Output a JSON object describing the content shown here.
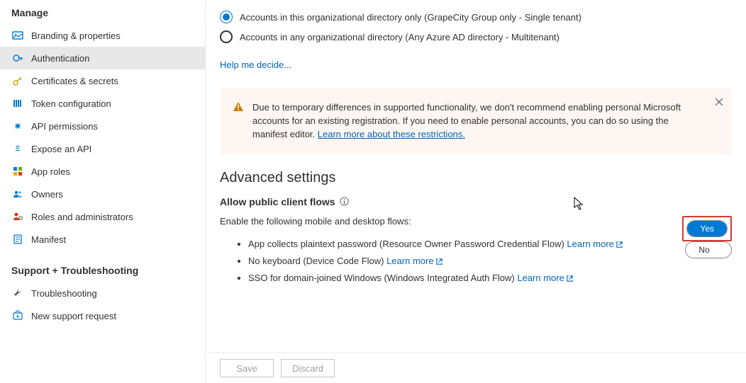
{
  "sidebar": {
    "heading_manage": "Manage",
    "heading_support": "Support + Troubleshooting",
    "items": [
      {
        "label": "Branding & properties",
        "icon": "branding"
      },
      {
        "label": "Authentication",
        "icon": "auth",
        "active": true
      },
      {
        "label": "Certificates & secrets",
        "icon": "key"
      },
      {
        "label": "Token configuration",
        "icon": "token"
      },
      {
        "label": "API permissions",
        "icon": "api-perm"
      },
      {
        "label": "Expose an API",
        "icon": "expose"
      },
      {
        "label": "App roles",
        "icon": "app-roles"
      },
      {
        "label": "Owners",
        "icon": "owners"
      },
      {
        "label": "Roles and administrators",
        "icon": "roles-admin"
      },
      {
        "label": "Manifest",
        "icon": "manifest"
      }
    ],
    "support_items": [
      {
        "label": "Troubleshooting",
        "icon": "wrench"
      },
      {
        "label": "New support request",
        "icon": "support"
      }
    ]
  },
  "radios": {
    "opt1": "Accounts in this organizational directory only (GrapeCity Group only - Single tenant)",
    "opt2": "Accounts in any organizational directory (Any Azure AD directory - Multitenant)"
  },
  "help_link": "Help me decide...",
  "warning": {
    "text_a": "Due to temporary differences in supported functionality, we don't recommend enabling personal Microsoft accounts for an existing registration. If you need to enable personal accounts, you can do so using the manifest editor.  ",
    "link": "Learn more about these restrictions."
  },
  "advanced": {
    "heading": "Advanced settings",
    "sub": "Allow public client flows",
    "desc": "Enable the following mobile and desktop flows:",
    "flows": [
      {
        "text": "App collects plaintext password (Resource Owner Password Credential Flow) ",
        "link": "Learn more"
      },
      {
        "text": "No keyboard (Device Code Flow) ",
        "link": "Learn more"
      },
      {
        "text": "SSO for domain-joined Windows (Windows Integrated Auth Flow) ",
        "link": "Learn more"
      }
    ],
    "toggle": {
      "yes": "Yes",
      "no": "No",
      "selected": "Yes"
    }
  },
  "footer": {
    "save": "Save",
    "discard": "Discard"
  }
}
